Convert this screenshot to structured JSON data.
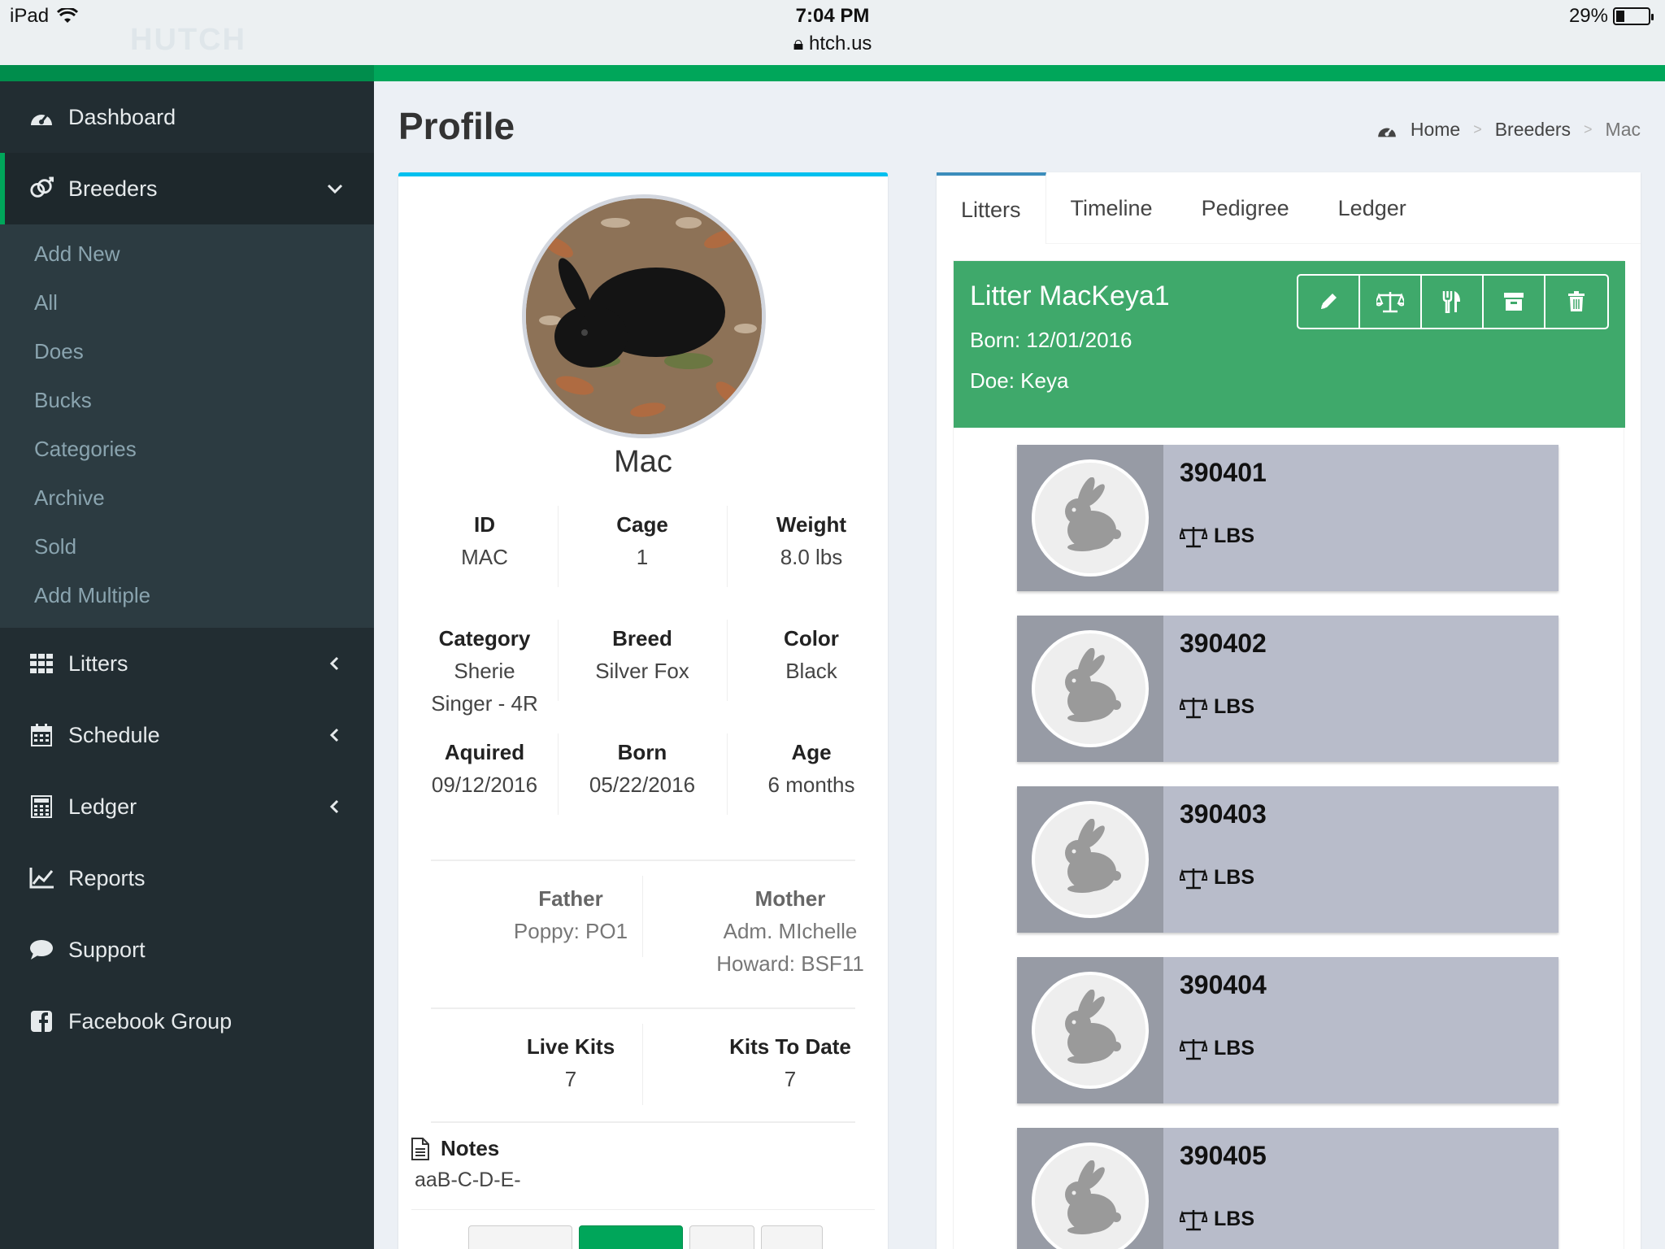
{
  "status_bar": {
    "device": "iPad",
    "time": "7:04 PM",
    "url": "htch.us",
    "battery": "29%"
  },
  "app": {
    "logo": "HUTCH"
  },
  "sidebar": {
    "items": [
      {
        "label": "Dashboard",
        "icon": "dashboard-icon"
      },
      {
        "label": "Breeders",
        "icon": "breeders-icon"
      },
      {
        "label": "Litters",
        "icon": "grid-icon"
      },
      {
        "label": "Schedule",
        "icon": "calendar-icon"
      },
      {
        "label": "Ledger",
        "icon": "calculator-icon"
      },
      {
        "label": "Reports",
        "icon": "chart-line-icon"
      },
      {
        "label": "Support",
        "icon": "comment-icon"
      },
      {
        "label": "Facebook Group",
        "icon": "facebook-icon"
      }
    ],
    "submenu": [
      "Add New",
      "All",
      "Does",
      "Bucks",
      "Categories",
      "Archive",
      "Sold",
      "Add Multiple"
    ]
  },
  "page": {
    "title": "Profile",
    "breadcrumb": [
      "Home",
      "Breeders",
      "Mac"
    ]
  },
  "profile": {
    "name": "Mac",
    "id_label": "ID",
    "id": "MAC",
    "cage_label": "Cage",
    "cage": "1",
    "weight_label": "Weight",
    "weight": "8.0 lbs",
    "category_label": "Category",
    "category_line1": "Sherie",
    "category_line2": "Singer - 4R",
    "breed_label": "Breed",
    "breed": "Silver Fox",
    "color_label": "Color",
    "color": "Black",
    "aquired_label": "Aquired",
    "aquired": "09/12/2016",
    "born_label": "Born",
    "born": "05/22/2016",
    "age_label": "Age",
    "age": "6 months",
    "father_label": "Father",
    "father": "Poppy: PO1",
    "mother_label": "Mother",
    "mother_line1": "Adm. MIchelle",
    "mother_line2": "Howard: BSF11",
    "live_kits_label": "Live Kits",
    "live_kits": "7",
    "kits_to_date_label": "Kits To Date",
    "kits_to_date": "7",
    "notes_label": "Notes",
    "notes": "aaB-C-D-E-"
  },
  "tabs": [
    "Litters",
    "Timeline",
    "Pedigree",
    "Ledger"
  ],
  "litter": {
    "title": "Litter MacKeya1",
    "born": "Born: 12/01/2016",
    "doe": "Doe: Keya",
    "actions": [
      "edit-icon",
      "scale-icon",
      "feed-icon",
      "archive-icon",
      "trash-icon"
    ]
  },
  "kits": [
    {
      "id": "390401",
      "weight": "LBS"
    },
    {
      "id": "390402",
      "weight": "LBS"
    },
    {
      "id": "390403",
      "weight": "LBS"
    },
    {
      "id": "390404",
      "weight": "LBS"
    },
    {
      "id": "390405",
      "weight": "LBS"
    }
  ],
  "colors": {
    "accent_green": "#00a65a",
    "litter_green": "#3fa96b",
    "sidebar": "#222d32",
    "info_blue": "#00c0ef"
  }
}
